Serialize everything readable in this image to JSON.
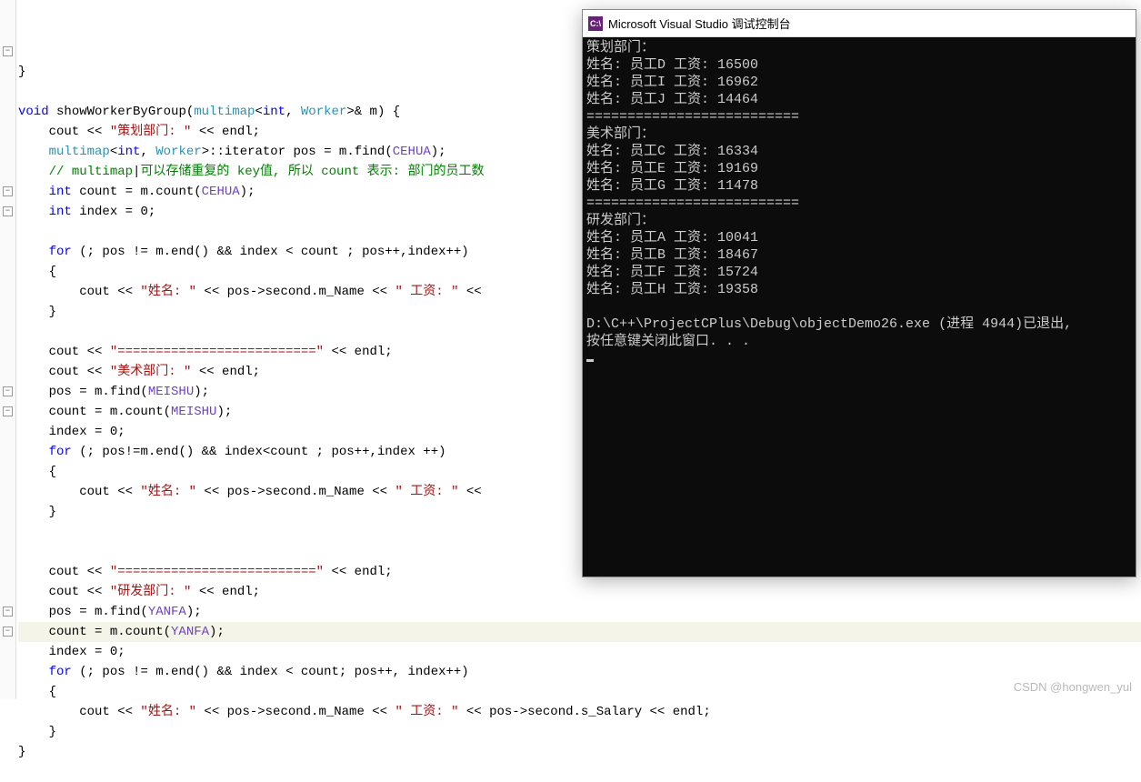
{
  "editor": {
    "code_tokens": [
      [
        [
          "id",
          "}"
        ]
      ],
      [],
      [
        [
          "kw",
          "void "
        ],
        [
          "id",
          "showWorkerByGroup("
        ],
        [
          "type",
          "multimap"
        ],
        [
          "op",
          "<"
        ],
        [
          "kw",
          "int"
        ],
        [
          "op",
          ", "
        ],
        [
          "type",
          "Worker"
        ],
        [
          "op",
          ">& "
        ],
        [
          "id",
          "m) {"
        ]
      ],
      [
        [
          "id",
          "    cout << "
        ],
        [
          "str",
          "\"策划部门: \""
        ],
        [
          "id",
          " << endl;"
        ]
      ],
      [
        [
          "id",
          "    "
        ],
        [
          "type",
          "multimap"
        ],
        [
          "op",
          "<"
        ],
        [
          "kw",
          "int"
        ],
        [
          "op",
          ", "
        ],
        [
          "type",
          "Worker"
        ],
        [
          "op",
          ">"
        ],
        [
          "id",
          "::iterator pos = m.find("
        ],
        [
          "vio",
          "CEHUA"
        ],
        [
          "id",
          ");"
        ]
      ],
      [
        [
          "id",
          "    "
        ],
        [
          "com",
          "// multimap"
        ],
        [
          "id",
          "|"
        ],
        [
          "com",
          "可以存储重复的 key值, 所以 count 表示: 部门的员工数"
        ]
      ],
      [
        [
          "id",
          "    "
        ],
        [
          "kw",
          "int"
        ],
        [
          "id",
          " count = m.count("
        ],
        [
          "vio",
          "CEHUA"
        ],
        [
          "id",
          ");"
        ]
      ],
      [
        [
          "id",
          "    "
        ],
        [
          "kw",
          "int"
        ],
        [
          "id",
          " index = "
        ],
        [
          "op",
          "0"
        ],
        [
          "id",
          ";"
        ]
      ],
      [],
      [
        [
          "id",
          "    "
        ],
        [
          "kw",
          "for"
        ],
        [
          "id",
          " (; pos != m.end() && index < count ; pos++,index++)"
        ]
      ],
      [
        [
          "id",
          "    {"
        ]
      ],
      [
        [
          "id",
          "        cout << "
        ],
        [
          "str",
          "\"姓名: \""
        ],
        [
          "id",
          " << pos->second.m_Name << "
        ],
        [
          "str",
          "\" 工资: \""
        ],
        [
          "id",
          " << "
        ]
      ],
      [
        [
          "id",
          "    }"
        ]
      ],
      [],
      [
        [
          "id",
          "    cout << "
        ],
        [
          "str",
          "\"==========================\""
        ],
        [
          "id",
          " << endl;"
        ]
      ],
      [
        [
          "id",
          "    cout << "
        ],
        [
          "str",
          "\"美术部门: \""
        ],
        [
          "id",
          " << endl;"
        ]
      ],
      [
        [
          "id",
          "    pos = m.find("
        ],
        [
          "vio",
          "MEISHU"
        ],
        [
          "id",
          ");"
        ]
      ],
      [
        [
          "id",
          "    count = m.count("
        ],
        [
          "vio",
          "MEISHU"
        ],
        [
          "id",
          ");"
        ]
      ],
      [
        [
          "id",
          "    index = "
        ],
        [
          "op",
          "0"
        ],
        [
          "id",
          ";"
        ]
      ],
      [
        [
          "id",
          "    "
        ],
        [
          "kw",
          "for"
        ],
        [
          "id",
          " (; pos!=m.end() && index<count ; pos++,index ++)"
        ]
      ],
      [
        [
          "id",
          "    {"
        ]
      ],
      [
        [
          "id",
          "        cout << "
        ],
        [
          "str",
          "\"姓名: \""
        ],
        [
          "id",
          " << pos->second.m_Name << "
        ],
        [
          "str",
          "\" 工资: \""
        ],
        [
          "id",
          " << "
        ]
      ],
      [
        [
          "id",
          "    }"
        ]
      ],
      [],
      [],
      [
        [
          "id",
          "    cout << "
        ],
        [
          "str",
          "\"==========================\""
        ],
        [
          "id",
          " << endl;"
        ]
      ],
      [
        [
          "id",
          "    cout << "
        ],
        [
          "str",
          "\"研发部门: \""
        ],
        [
          "id",
          " << endl;"
        ]
      ],
      [
        [
          "id",
          "    pos = m.find("
        ],
        [
          "vio",
          "YANFA"
        ],
        [
          "id",
          ");"
        ]
      ],
      [
        [
          "id",
          "    count = m.count("
        ],
        [
          "vio",
          "YANFA"
        ],
        [
          "id",
          ");"
        ]
      ],
      [
        [
          "id",
          "    index = "
        ],
        [
          "op",
          "0"
        ],
        [
          "id",
          ";"
        ]
      ],
      [
        [
          "id",
          "    "
        ],
        [
          "kw",
          "for"
        ],
        [
          "id",
          " (; pos != m.end() && index < count; pos++, index++)"
        ]
      ],
      [
        [
          "id",
          "    {"
        ]
      ],
      [
        [
          "id",
          "        cout << "
        ],
        [
          "str",
          "\"姓名: \""
        ],
        [
          "id",
          " << pos->second.m_Name << "
        ],
        [
          "str",
          "\" 工资: \""
        ],
        [
          "id",
          " << pos->second.s_Salary << endl;"
        ]
      ],
      [
        [
          "id",
          "    }"
        ]
      ],
      [
        [
          "id",
          "}"
        ]
      ]
    ],
    "highlight_line": 28,
    "fold_positions": [
      2,
      9,
      10,
      19,
      20,
      30,
      31
    ]
  },
  "console": {
    "title_icon": "C:\\",
    "title": "Microsoft Visual Studio 调试控制台",
    "lines": [
      "策划部门：",
      "姓名: 员工D 工资: 16500",
      "姓名: 员工I 工资: 16962",
      "姓名: 员工J 工资: 14464",
      "==========================",
      "美术部门：",
      "姓名: 员工C 工资: 16334",
      "姓名: 员工E 工资: 19169",
      "姓名: 员工G 工资: 11478",
      "==========================",
      "研发部门：",
      "姓名: 员工A 工资: 10041",
      "姓名: 员工B 工资: 18467",
      "姓名: 员工F 工资: 15724",
      "姓名: 员工H 工资: 19358",
      "",
      "D:\\C++\\ProjectCPlus\\Debug\\objectDemo26.exe (进程 4944)已退出,",
      "按任意键关闭此窗口. . ."
    ]
  },
  "watermark": "CSDN @hongwen_yul"
}
